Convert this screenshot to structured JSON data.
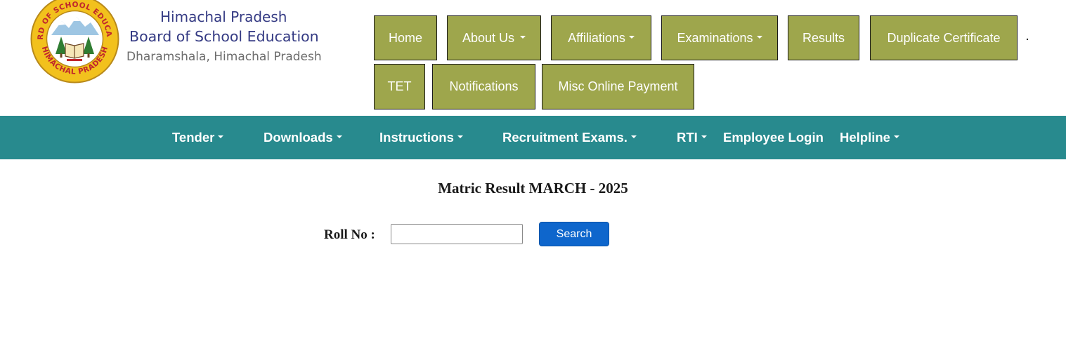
{
  "header": {
    "board_state": "Himachal Pradesh",
    "board_name": "Board of School Education",
    "board_location": "Dharamshala, Himachal Pradesh"
  },
  "logo": {
    "ring_text_top": "BOARD OF SCHOOL EDUCATION",
    "ring_text_bottom": "HIMACHAL PRADESH",
    "colors": {
      "ring": "#f2c11d",
      "ring_text": "#c0262c",
      "tree": "#2f7d32",
      "sky": "#9ec6e3"
    }
  },
  "top_nav": {
    "items": [
      {
        "label": "Home",
        "dropdown": false
      },
      {
        "label": "About Us",
        "dropdown": true
      },
      {
        "label": "Affiliations",
        "dropdown": true
      },
      {
        "label": "Examinations",
        "dropdown": true
      },
      {
        "label": "Results",
        "dropdown": false
      },
      {
        "label": "Duplicate Certificate",
        "dropdown": false
      },
      {
        "label": "TET",
        "dropdown": false
      },
      {
        "label": "Notifications",
        "dropdown": false
      },
      {
        "label": "Misc Online Payment",
        "dropdown": false
      }
    ],
    "color": "#9ea64c"
  },
  "main_nav": {
    "items": [
      {
        "label": "Tender",
        "dropdown": true
      },
      {
        "label": "Downloads",
        "dropdown": true
      },
      {
        "label": "Instructions",
        "dropdown": true
      },
      {
        "label": "Recruitment Exams.",
        "dropdown": true
      },
      {
        "label": "RTI",
        "dropdown": true
      },
      {
        "label": "Employee Login",
        "dropdown": false
      },
      {
        "label": "Helpline",
        "dropdown": true
      }
    ],
    "color": "#288a8e"
  },
  "result_form": {
    "title": "Matric Result MARCH - 2025",
    "roll_label": "Roll No :",
    "roll_value": "",
    "search_label": "Search",
    "button_color": "#0e66cc"
  }
}
